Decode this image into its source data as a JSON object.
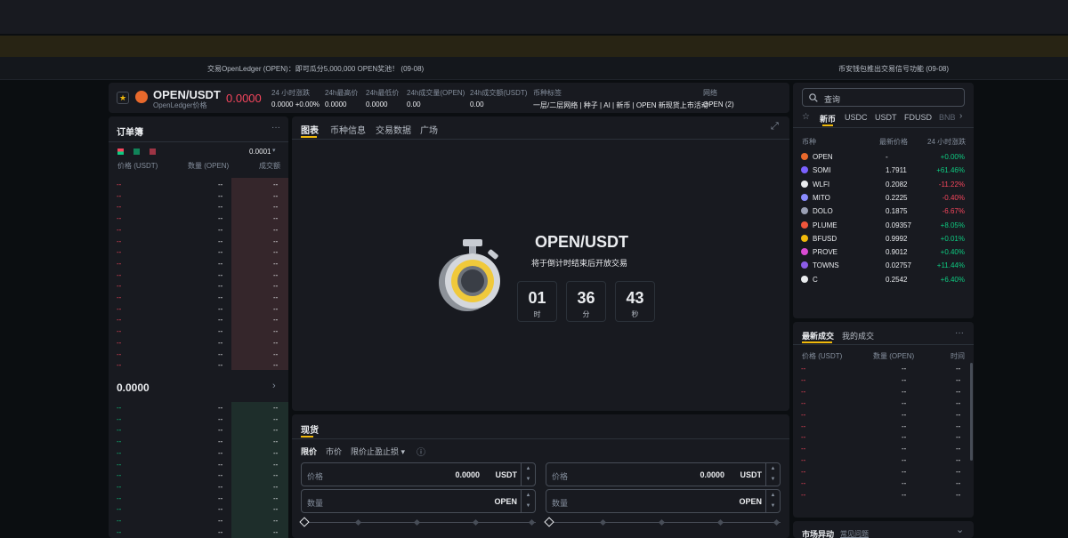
{
  "ticker_bar": {
    "left_announcement": "交易OpenLedger (OPEN)：即可瓜分5,000,000 OPEN奖池！ (09-08)",
    "right_announcement": "币安钱包推出交易信号功能 (09-08)"
  },
  "header": {
    "symbol": "OPEN/USDT",
    "subtitle": "OpenLedger价格",
    "price": "0.0000",
    "stats": [
      {
        "label": "24 小时涨跌",
        "value": "0.0000 +0.00%"
      },
      {
        "label": "24h最高价",
        "value": "0.0000"
      },
      {
        "label": "24h最低价",
        "value": "0.0000"
      },
      {
        "label": "24h成交量(OPEN)",
        "value": "0.00"
      },
      {
        "label": "24h成交额(USDT)",
        "value": "0.00"
      }
    ],
    "tags_label": "币种标签",
    "tags": "一层/二层网络 | 种子 | AI | 新币 | OPEN 新现货上市活动",
    "network_label": "网络",
    "network_value": "OPEN (2)"
  },
  "orderbook": {
    "title": "订单簿",
    "more": "···",
    "precision": "0.0001",
    "col_price": "价格 (USDT)",
    "col_qty": "数量 (OPEN)",
    "col_total": "成交额",
    "placeholder": "--",
    "mid_price": "0.0000",
    "mid_arrow": "›"
  },
  "chart_tabs": {
    "tabs": [
      "图表",
      "币种信息",
      "交易数据",
      "广场"
    ],
    "expand_icon": "⤢"
  },
  "countdown": {
    "symbol": "OPEN/USDT",
    "subtitle": "将于倒计时结束后开放交易",
    "hours": "01",
    "hours_label": "时",
    "minutes": "36",
    "minutes_label": "分",
    "seconds": "43",
    "seconds_label": "秒"
  },
  "spot": {
    "tab": "现货",
    "order_types": [
      "限价",
      "市价",
      "限价止盈止损 ▾"
    ],
    "info_icon": "ⓘ",
    "buy": {
      "price_label": "价格",
      "price_value": "0.0000",
      "price_unit": "USDT",
      "qty_label": "数量",
      "qty_unit": "OPEN"
    },
    "sell": {
      "price_label": "价格",
      "price_value": "0.0000",
      "price_unit": "USDT",
      "qty_label": "数量",
      "qty_unit": "OPEN"
    }
  },
  "markets": {
    "search_placeholder": "查询",
    "tabs": [
      "新币",
      "USDC",
      "USDT",
      "FDUSD",
      "BNB"
    ],
    "col_coin": "币种",
    "col_price": "最新价格",
    "col_change": "24 小时涨跌",
    "rows": [
      {
        "coin": "OPEN",
        "price": "-",
        "change": "+0.00%",
        "color": "#e8692c"
      },
      {
        "coin": "SOMI",
        "price": "1.7911",
        "change": "+61.46%",
        "color": "#7b61ff"
      },
      {
        "coin": "WLFI",
        "price": "0.2082",
        "change": "-11.22%",
        "color": "#eaecef"
      },
      {
        "coin": "MITO",
        "price": "0.2225",
        "change": "-0.40%",
        "color": "#8a8cff"
      },
      {
        "coin": "DOLO",
        "price": "0.1875",
        "change": "-6.67%",
        "color": "#9aa0b4"
      },
      {
        "coin": "PLUME",
        "price": "0.09357",
        "change": "+8.05%",
        "color": "#f0553b"
      },
      {
        "coin": "BFUSD",
        "price": "0.9992",
        "change": "+0.01%",
        "color": "#f0b90b"
      },
      {
        "coin": "PROVE",
        "price": "0.9012",
        "change": "+0.40%",
        "color": "#d94bd3"
      },
      {
        "coin": "TOWNS",
        "price": "0.02757",
        "change": "+11.44%",
        "color": "#8c5ce8"
      },
      {
        "coin": "C",
        "price": "0.2542",
        "change": "+6.40%",
        "color": "#eaecef"
      }
    ]
  },
  "trades": {
    "tabs": [
      "最新成交",
      "我的成交"
    ],
    "more": "···",
    "col_price": "价格 (USDT)",
    "col_qty": "数量 (OPEN)",
    "col_time": "时间",
    "placeholder": "--"
  },
  "market_moves": {
    "title": "市场异动",
    "link": "常见问题",
    "chevron": "⌄"
  }
}
